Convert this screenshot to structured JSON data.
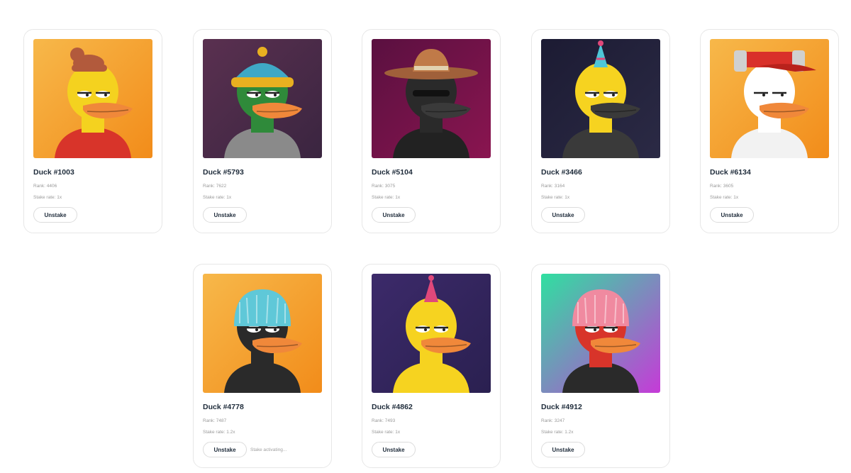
{
  "cards": [
    {
      "name": "Duck #1003",
      "rank": "Rank: 4406",
      "rate": "Stake rate: 1x",
      "button": "Unstake",
      "note": "",
      "bg": "#f28c1a",
      "bg2": "#f7b84a",
      "body": "#f4d21f",
      "beak": "#f0883a",
      "hat": "#b25a3c",
      "hat_type": "bun-hair",
      "shirt": "#d8342a",
      "eyewear": "none"
    },
    {
      "name": "Duck #5793",
      "rank": "Rank: 7622",
      "rate": "Stake rate: 1x",
      "button": "Unstake",
      "note": "",
      "bg": "#3a2540",
      "bg2": "#5a3050",
      "body": "#2f8a3a",
      "beak": "#f0883a",
      "hat": "#3fa8c6",
      "hat_type": "beanie",
      "shirt": "#8a8a8a",
      "eyewear": "none"
    },
    {
      "name": "Duck #5104",
      "rank": "Rank: 3075",
      "rate": "Stake rate: 1x",
      "button": "Unstake",
      "note": "",
      "bg": "#8a1550",
      "bg2": "#5a1040",
      "body": "#2a2a2a",
      "beak": "#3a3a3a",
      "hat": "#a0603a",
      "hat_type": "sombrero",
      "shirt": "#222222",
      "eyewear": "eyepatch"
    },
    {
      "name": "Duck #3466",
      "rank": "Rank: 3164",
      "rate": "Stake rate: 1x",
      "button": "Unstake",
      "note": "",
      "bg": "#2b2a45",
      "bg2": "#1c1b33",
      "body": "#f6d320",
      "beak": "#3a3a3a",
      "hat": "#4ec7d8",
      "hat_type": "party",
      "shirt": "#3a3a3a",
      "eyewear": "none"
    },
    {
      "name": "Duck #6134",
      "rank": "Rank: 3605",
      "rate": "Stake rate: 1x",
      "button": "Unstake",
      "note": "",
      "bg": "#f28c1a",
      "bg2": "#f7b84a",
      "body": "#ffffff",
      "beak": "#f0883a",
      "hat": "#d9302a",
      "hat_type": "beer-hat",
      "shirt": "#f2f2f2",
      "eyewear": "none"
    },
    {
      "name": "Duck #4778",
      "rank": "Rank: 7487",
      "rate": "Stake rate: 1.2x",
      "button": "Unstake",
      "note": "Stake activating...",
      "bg": "#f28c1a",
      "bg2": "#f7b84a",
      "body": "#2a2a2a",
      "beak": "#f0883a",
      "hat": "#5fc8d8",
      "hat_type": "bowl-hair",
      "shirt": "#2a2a2a",
      "eyewear": "none"
    },
    {
      "name": "Duck #4862",
      "rank": "Rank: 7493",
      "rate": "Stake rate: 1x",
      "button": "Unstake",
      "note": "",
      "bg": "#2a2050",
      "bg2": "#3c2a6a",
      "body": "#f6d320",
      "beak": "#f0883a",
      "hat": "#e0487a",
      "hat_type": "party",
      "shirt": "#f6d320",
      "eyewear": "none"
    },
    {
      "name": "Duck #4912",
      "rank": "Rank: 3247",
      "rate": "Stake rate: 1.2x",
      "button": "Unstake",
      "note": "",
      "bg": "#c63ad8",
      "bg2": "#2fe0a0",
      "body": "#d8342a",
      "beak": "#f0883a",
      "hat": "#f08aa0",
      "hat_type": "bowl-hair",
      "shirt": "#2a2a2a",
      "eyewear": "none"
    }
  ]
}
